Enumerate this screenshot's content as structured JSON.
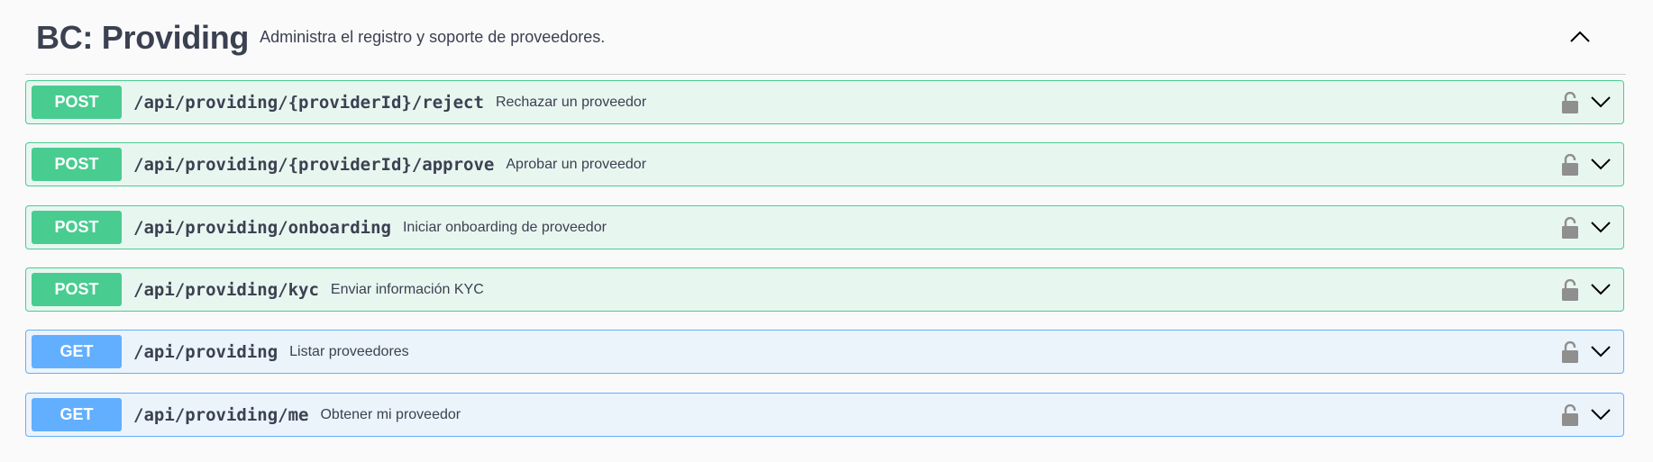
{
  "section": {
    "title": "BC: Providing",
    "description": "Administra el registro y soporte de proveedores."
  },
  "icons": {
    "collapse": "chevron-up-icon",
    "lock": "lock-open-icon",
    "expand": "chevron-down-icon"
  },
  "colors": {
    "post": "#49cc90",
    "post_bg": "#e8f6f0",
    "get": "#61affe",
    "get_bg": "#ebf3fb",
    "text": "#3b4151"
  },
  "operations": [
    {
      "method": "POST",
      "path": "/api/providing/{providerId}/reject",
      "summary": "Rechazar un proveedor"
    },
    {
      "method": "POST",
      "path": "/api/providing/{providerId}/approve",
      "summary": "Aprobar un proveedor"
    },
    {
      "method": "POST",
      "path": "/api/providing/onboarding",
      "summary": "Iniciar onboarding de proveedor"
    },
    {
      "method": "POST",
      "path": "/api/providing/kyc",
      "summary": "Enviar información KYC"
    },
    {
      "method": "GET",
      "path": "/api/providing",
      "summary": "Listar proveedores"
    },
    {
      "method": "GET",
      "path": "/api/providing/me",
      "summary": "Obtener mi proveedor"
    }
  ]
}
